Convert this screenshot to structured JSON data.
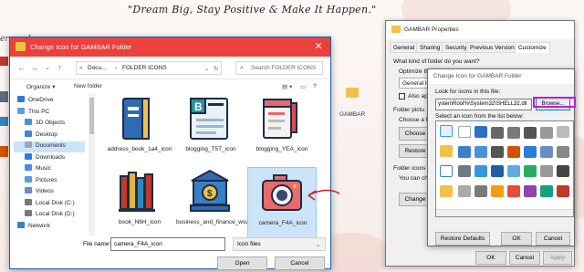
{
  "desktop": {
    "tagline": "\"Dream Big, Stay Positive & Make It Happen.\"",
    "left_label": "ersonal",
    "folder_label": "GAMBAR"
  },
  "dialog": {
    "title": "Change Icon for GAMBAR Folder",
    "close": "✕",
    "breadcrumb": [
      "Docu...",
      "FOLDER ICONS"
    ],
    "search_placeholder": "Search FOLDER ICONS",
    "organize": "Organize ▾",
    "new_folder": "New folder",
    "sidebar": [
      {
        "label": "OneDrive",
        "color": "#2b7cd3"
      },
      {
        "label": "This PC",
        "color": "#5aa0e0"
      },
      {
        "label": "3D Objects",
        "color": "#4a90d9"
      },
      {
        "label": "Desktop",
        "color": "#3a86d4"
      },
      {
        "label": "Documents",
        "color": "#9aa6b3"
      },
      {
        "label": "Downloads",
        "color": "#2a7fd6"
      },
      {
        "label": "Music",
        "color": "#4b8dd8"
      },
      {
        "label": "Pictures",
        "color": "#5b9ad9"
      },
      {
        "label": "Videos",
        "color": "#6a8cc7"
      },
      {
        "label": "Local Disk (C:)",
        "color": "#777777"
      },
      {
        "label": "Local Disk (D:)",
        "color": "#777777"
      },
      {
        "label": "Network",
        "color": "#3d7fc8"
      }
    ],
    "files": [
      {
        "name": "address_book_1a4_icon"
      },
      {
        "name": "blogging_T5T_icon"
      },
      {
        "name": "blogging_YEA_icon"
      },
      {
        "name": "book_N6H_icon"
      },
      {
        "name": "business_and_finance_wsu_icon"
      },
      {
        "name": "camera_F4A_icon"
      }
    ],
    "file_name_label": "File name:",
    "file_name_value": "camera_F4A_icon",
    "file_type": "Icon files",
    "open": "Open",
    "cancel": "Cancel"
  },
  "properties": {
    "title": "GAMBAR Properties",
    "tabs": [
      "General",
      "Sharing",
      "Security",
      "Previous Versions",
      "Customize"
    ],
    "active_tab": "Customize",
    "question": "What kind of folder do you want?",
    "optimize": "Optimize th",
    "general_item": "General ite",
    "also_apply": "Also ap",
    "folder_pictures": "Folder pictu",
    "choose_file": "Choose a fi",
    "choose_btn": "Choose",
    "restore_btn": "Restore",
    "folder_icons": "Folder icons",
    "you_can": "You can ch",
    "change_btn": "Change",
    "ok": "OK",
    "cancel": "Cancel",
    "apply": "Apply"
  },
  "change_icon": {
    "title": "Change Icon for GAMBAR Folder",
    "look_label": "Look for icons in this file:",
    "path": "ystemRoot%\\System32\\SHELL32.dll",
    "browse": "Browse...",
    "select_label": "Select an icon from the list below:",
    "restore_defaults": "Restore Defaults",
    "ok": "OK",
    "cancel": "Cancel"
  }
}
